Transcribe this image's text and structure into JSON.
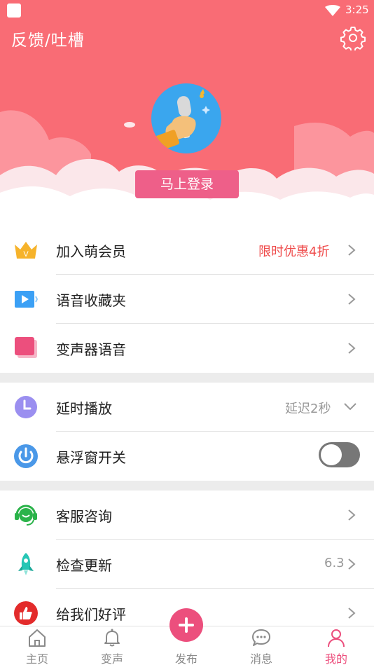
{
  "status_bar": {
    "time": "3:25"
  },
  "header": {
    "title": "反馈/吐槽",
    "login_label": "马上登录"
  },
  "sections": {
    "vip": {
      "join_label": "加入萌会员",
      "join_value": "限时优惠4折",
      "favorites_label": "语音收藏夹",
      "voice_label": "变声器语音"
    },
    "playback": {
      "delay_label": "延时播放",
      "delay_value": "延迟2秒",
      "float_label": "悬浮窗开关",
      "float_enabled": false
    },
    "support": {
      "service_label": "客服咨询",
      "update_label": "检查更新",
      "update_value": "6.3",
      "rate_label": "给我们好评"
    }
  },
  "bottom_nav": {
    "home": "主页",
    "voice": "变声",
    "publish": "发布",
    "messages": "消息",
    "mine": "我的"
  },
  "colors": {
    "header": "#f96c75",
    "accent": "#ec4f7d",
    "promo": "#ef4b4b"
  }
}
